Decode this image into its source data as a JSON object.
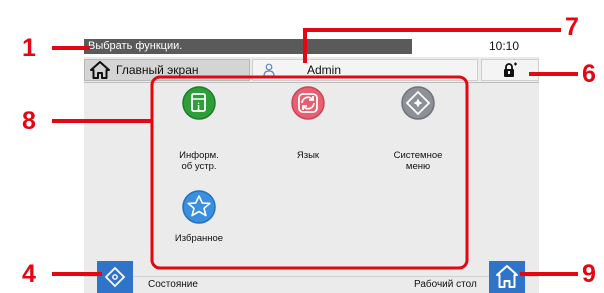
{
  "status_bar": {
    "message": "Выбрать функции.",
    "time": "10:10"
  },
  "tab_bar": {
    "home_tab_label": "Главный экран",
    "user_name": "Admin"
  },
  "functions": [
    {
      "label": "Информ.\nоб устр.",
      "icon": "device-info-icon",
      "color": "#2e9e3a"
    },
    {
      "label": "Язык",
      "icon": "language-icon",
      "color": "#e8606f"
    },
    {
      "label": "Системное\nменю",
      "icon": "system-menu-icon",
      "color": "#8d9096"
    },
    {
      "label": "Избранное",
      "icon": "favorites-star-icon",
      "color": "#3a8fe0"
    }
  ],
  "bottom_bar": {
    "status_label": "Состояние",
    "desktop_label": "Рабочий стол"
  },
  "callouts": [
    "1",
    "7",
    "6",
    "8",
    "4",
    "9"
  ],
  "colors": {
    "accent_blue": "#2f74c9",
    "callout_red": "#e30613",
    "message_bg": "#5a5a5a",
    "screen_bg": "#ebebeb"
  }
}
